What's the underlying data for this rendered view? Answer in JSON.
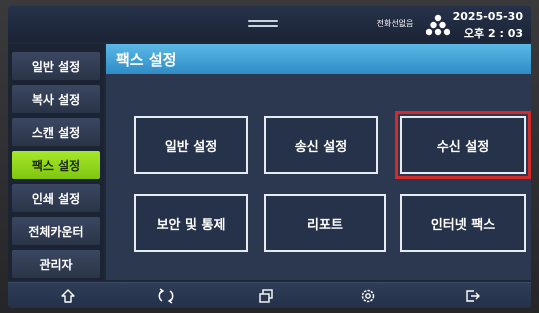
{
  "status": {
    "network_text": "전화선없음",
    "date": "2025-05-30",
    "time": "오후 2 : 03"
  },
  "sidebar": {
    "items": [
      {
        "label": "일반 설정",
        "active": false
      },
      {
        "label": "복사 설정",
        "active": false
      },
      {
        "label": "스캔 설정",
        "active": false
      },
      {
        "label": "팩스 설정",
        "active": true
      },
      {
        "label": "인쇄 설정",
        "active": false
      },
      {
        "label": "전체카운터",
        "active": false
      },
      {
        "label": "관리자",
        "active": false
      }
    ]
  },
  "content": {
    "title": "팩스 설정",
    "tiles": [
      {
        "label": "일반 설정"
      },
      {
        "label": "송신 설정"
      },
      {
        "label": "수신 설정",
        "highlighted": true
      },
      {
        "label": "보안 및 통제"
      },
      {
        "label": "리포트"
      },
      {
        "label": "인터넷 팩스"
      }
    ]
  },
  "bottombar": {
    "icons": [
      "home-icon",
      "refresh-icon",
      "copy-jobs-icon",
      "settings-gear-icon",
      "logout-icon"
    ]
  },
  "colors": {
    "active_sidebar": "#9ad924",
    "title_bar": "#3fa2d6",
    "highlight_outline": "#d42a2a"
  }
}
